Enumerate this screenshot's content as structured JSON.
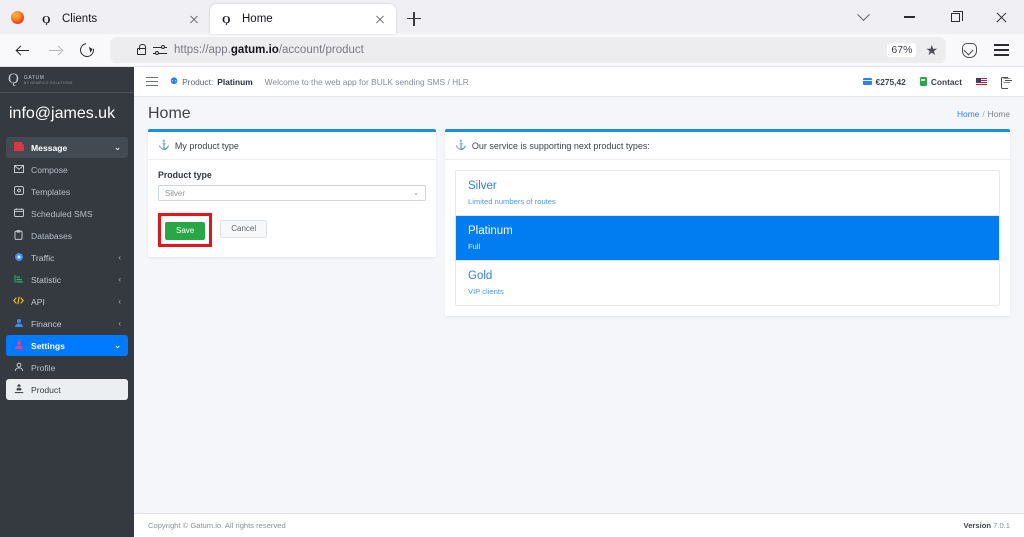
{
  "browser": {
    "tabs": [
      {
        "title": "Clients",
        "active": false,
        "favicon": "gatum-favicon"
      },
      {
        "title": "Home",
        "active": true,
        "favicon": "gatum-favicon"
      }
    ],
    "new_tab_label": "+",
    "url_prefix": "https://app.",
    "url_domain": "gatum.io",
    "url_suffix": "/account/product",
    "zoom_level": "67%",
    "icons": {
      "shield": "shield-icon",
      "lock": "lock-icon",
      "permissions": "permissions-icon",
      "bookmark": "★",
      "pocket": "pocket-icon",
      "menu": "hamburger-menu-icon"
    }
  },
  "sidebar": {
    "brand": {
      "mark": "Ǫ",
      "name": "GATUM",
      "tagline": "BY GEMPICO SOLUTIONS"
    },
    "user_email": "info@james.uk",
    "items": [
      {
        "label": "Message",
        "icon": "message-icon",
        "caret": "⌄",
        "state": "group-open"
      },
      {
        "label": "Compose",
        "icon": "envelope-icon",
        "caret": "",
        "state": "sub"
      },
      {
        "label": "Templates",
        "icon": "templates-icon",
        "caret": "",
        "state": "sub"
      },
      {
        "label": "Scheduled SMS",
        "icon": "calendar-icon",
        "caret": "",
        "state": "sub"
      },
      {
        "label": "Databases",
        "icon": "database-icon",
        "caret": "",
        "state": "sub"
      },
      {
        "label": "Traffic",
        "icon": "traffic-icon",
        "caret": "‹",
        "state": "normal"
      },
      {
        "label": "Statistic",
        "icon": "statistic-icon",
        "caret": "‹",
        "state": "normal"
      },
      {
        "label": "API",
        "icon": "code-icon",
        "caret": "‹",
        "state": "normal"
      },
      {
        "label": "Finance",
        "icon": "finance-icon",
        "caret": "‹",
        "state": "normal"
      },
      {
        "label": "Settings",
        "icon": "settings-user-icon",
        "caret": "⌄",
        "state": "active-blue"
      },
      {
        "label": "Profile",
        "icon": "profile-icon",
        "caret": "",
        "state": "sub"
      },
      {
        "label": "Product",
        "icon": "product-icon",
        "caret": "",
        "state": "active-white"
      }
    ]
  },
  "topbar": {
    "menu_toggle": "hamburger-icon",
    "product_prefix": "Product:",
    "product_value": "Platinum",
    "welcome": "Welcome to the web app for BULK sending SMS / HLR",
    "balance": "€275,42",
    "contact": "Contact",
    "language_flag": "us-flag-icon",
    "logout": "logout-icon"
  },
  "page": {
    "title": "Home",
    "breadcrumb_home": "Home",
    "breadcrumb_sep": "/",
    "breadcrumb_current": "Home"
  },
  "my_product_card": {
    "header": "My product type",
    "header_icon": "product-icon",
    "field_label": "Product type",
    "select_value": "Silver",
    "select_caret": "⌄",
    "save_label": "Save",
    "cancel_label": "Cancel"
  },
  "services_card": {
    "header": "Our service is supporting next product types:",
    "header_icon": "product-icon",
    "products": [
      {
        "name": "Silver",
        "desc": "Limited numbers of routes",
        "selected": false
      },
      {
        "name": "Platinum",
        "desc": "Full",
        "selected": true
      },
      {
        "name": "Gold",
        "desc": "VIP clients",
        "selected": false
      }
    ]
  },
  "footer": {
    "copyright": "Copyright © Gatum.io. All rights reserved",
    "version_label": "Version",
    "version_number": "7.0.1"
  },
  "colors": {
    "accent_blue": "#027cf1",
    "sidebar_bg": "#343a40",
    "save_green": "#28a745",
    "annotation_red": "#e8131c",
    "content_bg": "#f4f6f9"
  }
}
